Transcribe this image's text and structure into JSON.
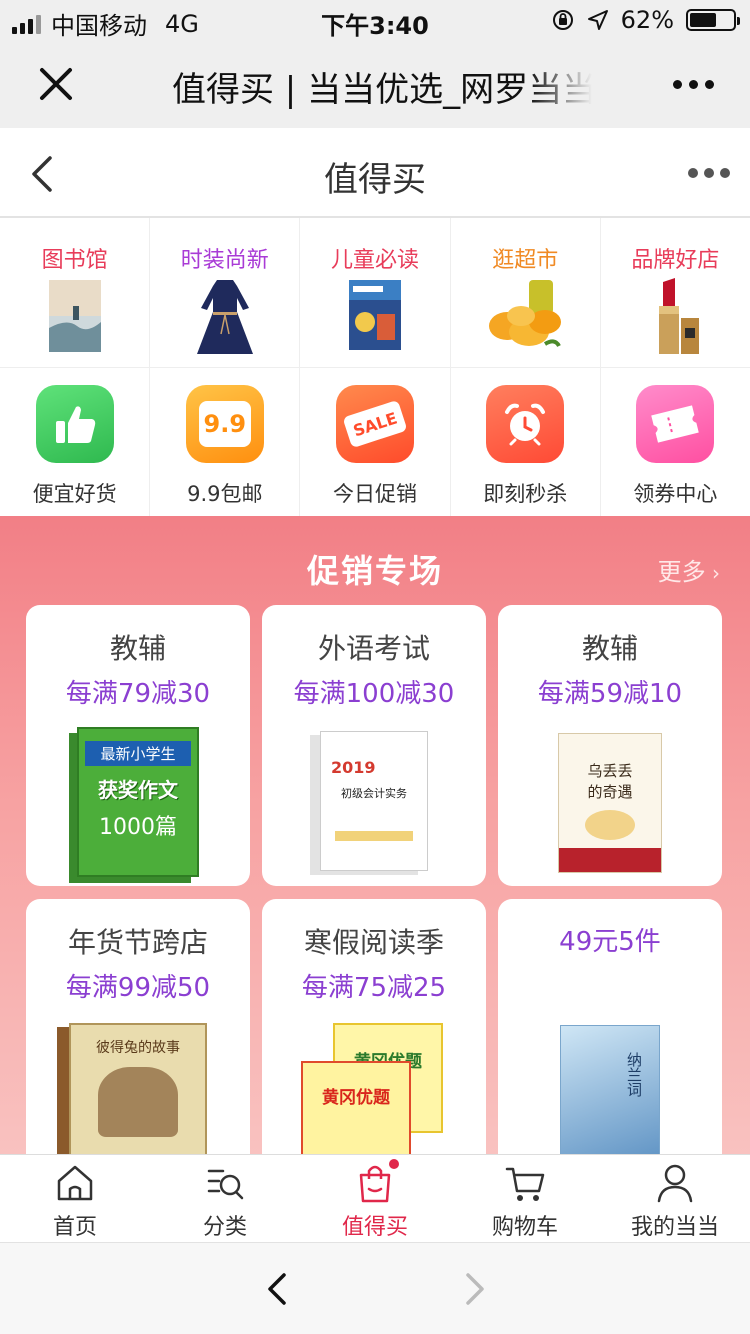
{
  "status_bar": {
    "carrier": "中国移动",
    "network": "4G",
    "time": "下午3:40",
    "battery": "62%",
    "battery_level": 0.62
  },
  "webview": {
    "title": "值得买 | 当当优选_网罗当当"
  },
  "header": {
    "title": "值得买"
  },
  "categories": [
    {
      "label": "图书馆",
      "color": "#e83c5a"
    },
    {
      "label": "时装尚新",
      "color": "#a93bd6"
    },
    {
      "label": "儿童必读",
      "color": "#e83c5a"
    },
    {
      "label": "逛超市",
      "color": "#f08a24"
    },
    {
      "label": "品牌好店",
      "color": "#e83c5a"
    }
  ],
  "quick_links": [
    {
      "label": "便宜好货",
      "icon": "thumbs-up-icon",
      "color": "#3ecf5c"
    },
    {
      "label": "9.9包邮",
      "icon": "nine-nine-icon",
      "color": "#ff9e1b",
      "text": "9.9"
    },
    {
      "label": "今日促销",
      "icon": "sale-tag-icon",
      "color": "#ff6a3a",
      "text": "SALE"
    },
    {
      "label": "即刻秒杀",
      "icon": "alarm-clock-icon",
      "color": "#ff5f43"
    },
    {
      "label": "领券中心",
      "icon": "coupon-icon",
      "color": "#ff5fa8"
    }
  ],
  "promo": {
    "title": "促销专场",
    "more": "更多",
    "cards": [
      {
        "category": "教辅",
        "rule": "每满79减30",
        "book_text": [
          "最新小学生",
          "获奖作文",
          "1000篇"
        ]
      },
      {
        "category": "外语考试",
        "rule": "每满100减30",
        "book_text": [
          "2019",
          "初级会计实务"
        ]
      },
      {
        "category": "教辅",
        "rule": "每满59减10",
        "book_text": [
          "乌丢丢",
          "的奇遇"
        ]
      },
      {
        "category": "年货节跨店",
        "rule": "每满99减50",
        "book_text": [
          "彼得兔的故事"
        ]
      },
      {
        "category": "寒假阅读季",
        "rule": "每满75减25",
        "book_text": [
          "黄冈优题",
          "黄冈优题"
        ]
      },
      {
        "category": "",
        "rule": "49元5件",
        "book_text": [
          "纳兰词"
        ]
      }
    ]
  },
  "tabbar": [
    {
      "label": "首页",
      "icon": "home-icon",
      "active": false
    },
    {
      "label": "分类",
      "icon": "category-search-icon",
      "active": false
    },
    {
      "label": "值得买",
      "icon": "shopping-bag-icon",
      "active": true
    },
    {
      "label": "购物车",
      "icon": "cart-icon",
      "active": false
    },
    {
      "label": "我的当当",
      "icon": "user-icon",
      "active": false
    }
  ]
}
